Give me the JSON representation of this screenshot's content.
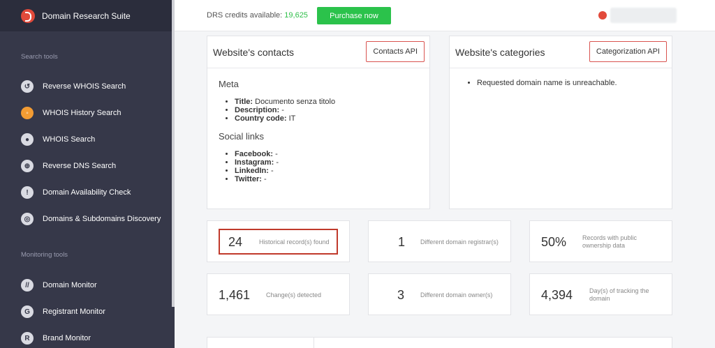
{
  "app": {
    "name": "Domain Research Suite"
  },
  "sidebar": {
    "section_search": "Search tools",
    "section_monitoring": "Monitoring tools",
    "search_items": [
      {
        "label": "Reverse WHOIS Search",
        "icon": "reverse-whois-icon",
        "glyph": "↺"
      },
      {
        "label": "WHOIS History Search",
        "icon": "history-icon",
        "glyph": "◦"
      },
      {
        "label": "WHOIS Search",
        "icon": "user-search-icon",
        "glyph": "●"
      },
      {
        "label": "Reverse DNS Search",
        "icon": "globe-icon",
        "glyph": "⊕"
      },
      {
        "label": "Domain Availability Check",
        "icon": "alert-icon",
        "glyph": "!"
      },
      {
        "label": "Domains & Subdomains Discovery",
        "icon": "target-icon",
        "glyph": "◎"
      }
    ],
    "monitoring_items": [
      {
        "label": "Domain Monitor",
        "icon": "domain-monitor-icon",
        "glyph": "//"
      },
      {
        "label": "Registrant Monitor",
        "icon": "registrant-monitor-icon",
        "glyph": "G"
      },
      {
        "label": "Brand Monitor",
        "icon": "brand-monitor-icon",
        "glyph": "R"
      }
    ]
  },
  "topbar": {
    "credits_label": "DRS credits available:",
    "credits_value": "19,625",
    "purchase_label": "Purchase now"
  },
  "contacts": {
    "title": "Website's contacts",
    "button": "Contacts API",
    "meta_heading": "Meta",
    "meta": [
      {
        "key": "Title:",
        "value": "Documento senza titolo"
      },
      {
        "key": "Description:",
        "value": "-"
      },
      {
        "key": "Country code:",
        "value": "IT"
      }
    ],
    "social_heading": "Social links",
    "social": [
      {
        "key": "Facebook:",
        "value": "-"
      },
      {
        "key": "Instagram:",
        "value": "-"
      },
      {
        "key": "LinkedIn:",
        "value": "-"
      },
      {
        "key": "Twitter:",
        "value": "-"
      }
    ]
  },
  "categories": {
    "title": "Website's categories",
    "button": "Categorization API",
    "items": [
      "Requested domain name is unreachable."
    ]
  },
  "stats": [
    {
      "value": "24",
      "label": "Historical record(s) found"
    },
    {
      "value": "1",
      "label": "Different domain registrar(s)"
    },
    {
      "value": "50%",
      "label": "Records with public ownership data"
    },
    {
      "value": "1,461",
      "label": "Change(s) detected"
    },
    {
      "value": "3",
      "label": "Different domain owner(s)"
    },
    {
      "value": "4,394",
      "label": "Day(s) of tracking the domain"
    }
  ],
  "colors": {
    "sidebar": "#363849",
    "accent_green": "#2bc24b",
    "accent_red": "#e24a3b",
    "active_icon": "#f39c33"
  }
}
